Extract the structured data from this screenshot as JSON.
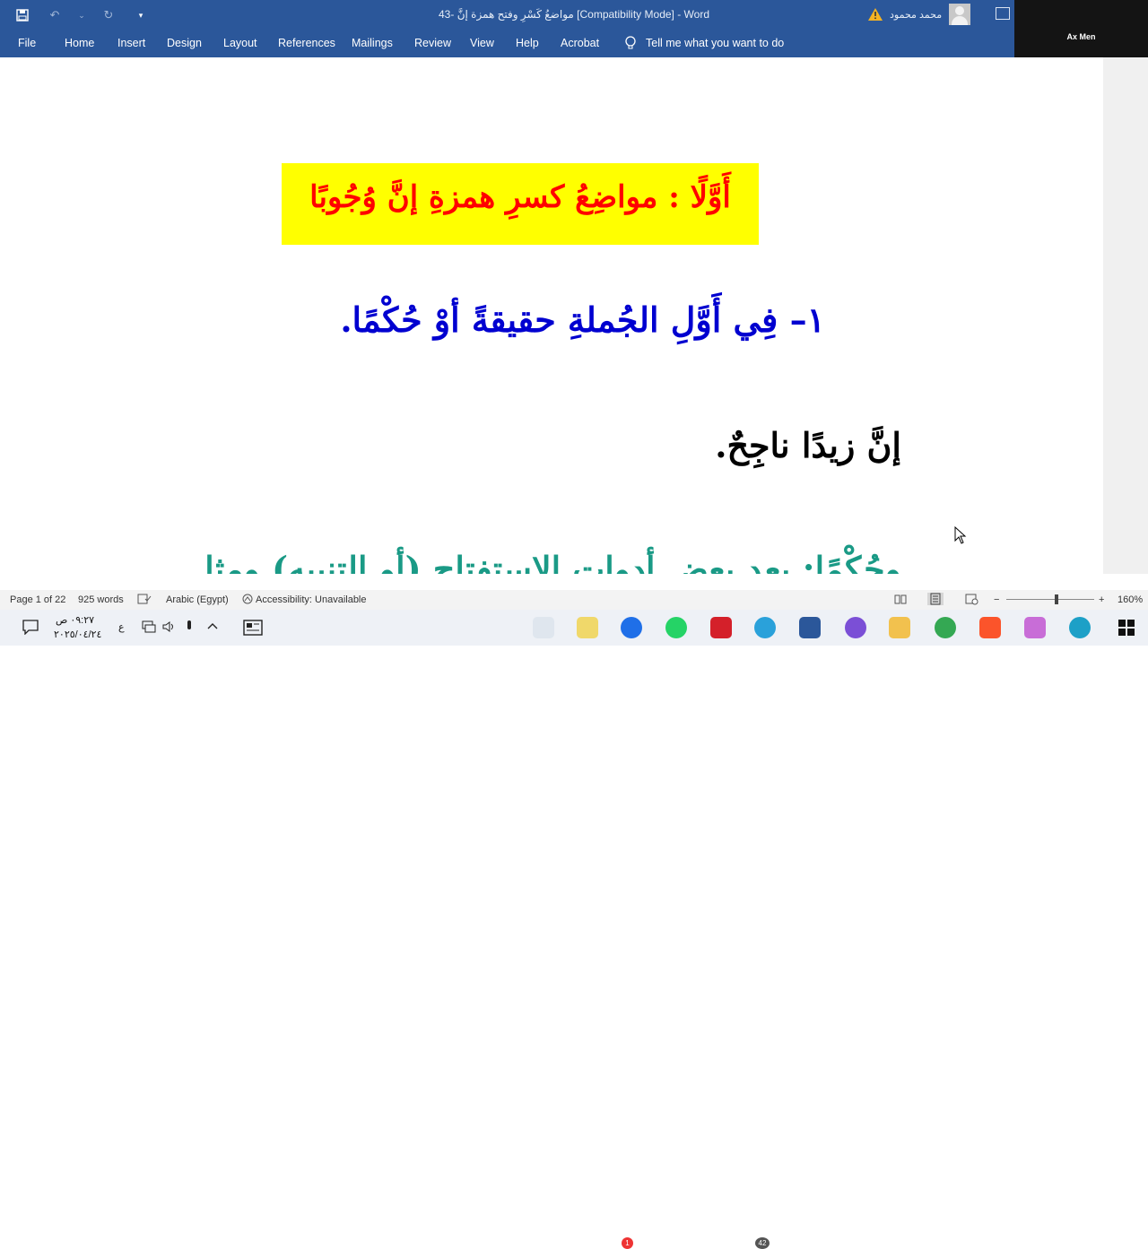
{
  "window": {
    "title": "43- مواضعُ كَسْرِ وفتح همزة إنَّ [Compatibility Mode]  -  Word",
    "user_name": "محمد محمود"
  },
  "ribbon_tabs": [
    "File",
    "Home",
    "Insert",
    "Design",
    "Layout",
    "References",
    "Mailings",
    "Review",
    "View",
    "Help",
    "Acrobat"
  ],
  "tell_me": "Tell me what you want to do",
  "video_overlay": {
    "name": "Ax Men"
  },
  "document": {
    "heading": "أَوَّلًا : مواضِعُ كسرِ همزةِ إنَّ وُجُوبًا",
    "line1": "١– فِي أَوَّلِ الجُملةِ حقيقةً أوْ حُكْمًا.",
    "line2": "إنَّ زيدًا ناجِحٌ.",
    "line3": "وحُكْمًا: بعد بعضِ أدواتِ الاستفتاحِ (أو التنبيه) ومثل"
  },
  "statusbar": {
    "page": "Page 1 of 22",
    "words": "925 words",
    "language": "Arabic (Egypt)",
    "accessibility": "Accessibility: Unavailable",
    "zoom": "160%",
    "zoom_minus": "−",
    "zoom_plus": "+"
  },
  "taskbar": {
    "time": "٠٩:٢٧ ص",
    "date": "٢٠٢٥/٠٤/٢٤",
    "lang": "ع",
    "badges": {
      "mail": "1",
      "telegram": "42"
    }
  },
  "colors": {
    "word_blue": "#2b579a",
    "heading_bg": "#ffff00",
    "heading_text": "#ff0000",
    "line1": "#0000d0",
    "line3": "#1a9a86"
  }
}
